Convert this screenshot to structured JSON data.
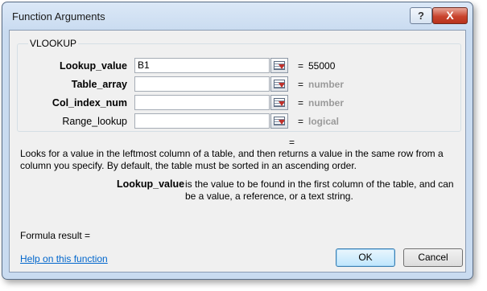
{
  "window": {
    "title": "Function Arguments",
    "help_glyph": "?",
    "close_glyph": "X"
  },
  "function_group": {
    "name": "VLOOKUP",
    "args": [
      {
        "label": "Lookup_value",
        "value": "B1",
        "equals": "=",
        "result": "55000"
      },
      {
        "label": "Table_array",
        "value": "",
        "equals": "=",
        "result": "number"
      },
      {
        "label": "Col_index_num",
        "value": "",
        "equals": "=",
        "result": "number"
      },
      {
        "label": "Range_lookup",
        "value": "",
        "equals": "=",
        "result": "logical"
      }
    ],
    "function_result_equals": "="
  },
  "description": "Looks for a value in the leftmost column of a table, and then returns a value in the same row from a column you specify. By default, the table must be sorted in an ascending order.",
  "arg_help": {
    "name": "Lookup_value",
    "text": "is the value to be found in the first column of the table, and can be a value, a reference, or a text string."
  },
  "formula_result_label": "Formula result =",
  "help_link": "Help on this function",
  "buttons": {
    "ok": "OK",
    "cancel": "Cancel"
  },
  "icons": {
    "ref_button": "collapse-dialog-icon"
  }
}
